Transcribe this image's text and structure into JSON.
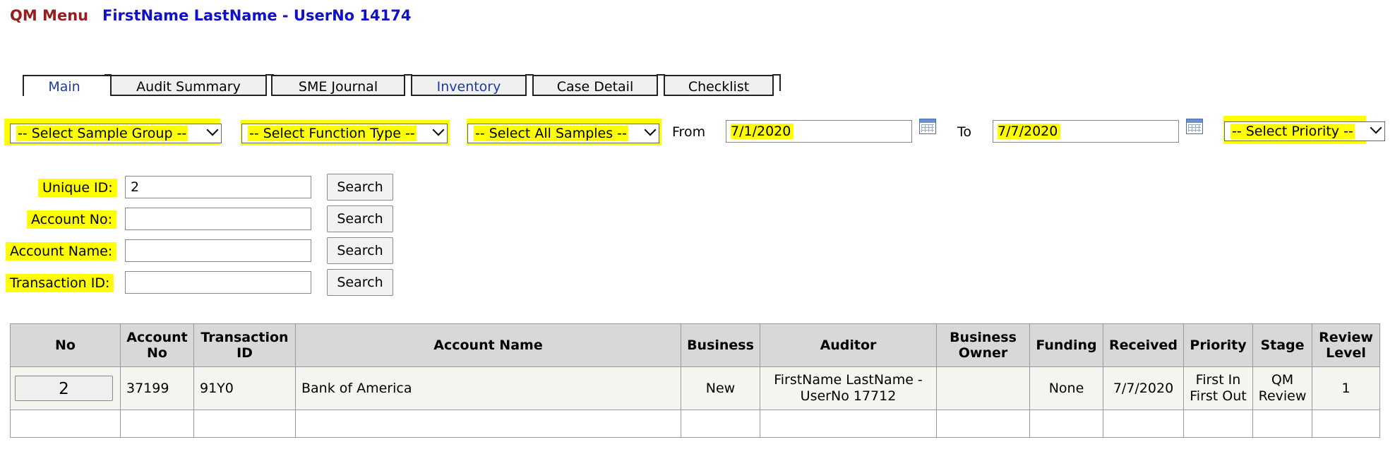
{
  "header": {
    "app_title": "QM Menu",
    "user": "FirstName LastName - UserNo 14174"
  },
  "tabs": [
    {
      "label": "Main"
    },
    {
      "label": "Audit Summary"
    },
    {
      "label": "SME Journal"
    },
    {
      "label": "Inventory"
    },
    {
      "label": "Case Detail"
    },
    {
      "label": "Checklist"
    }
  ],
  "filters": {
    "sample_group": "-- Select Sample Group --",
    "function_type": "-- Select Function Type --",
    "all_samples": "-- Select All Samples --",
    "from_label": "From",
    "from_value": "7/1/2020",
    "to_label": "To",
    "to_value": "7/7/2020",
    "priority": "-- Select Priority --"
  },
  "search": {
    "button_label": "Search",
    "fields": [
      {
        "label": "Unique ID:",
        "value": "2"
      },
      {
        "label": "Account No:",
        "value": ""
      },
      {
        "label": "Account Name:",
        "value": ""
      },
      {
        "label": "Transaction ID:",
        "value": ""
      }
    ]
  },
  "table": {
    "headers": {
      "no": "No",
      "account_no": "Account No",
      "transaction_id": "Transaction ID",
      "account_name": "Account Name",
      "business": "Business",
      "auditor": "Auditor",
      "business_owner": "Business Owner",
      "funding": "Funding",
      "received": "Received",
      "priority": "Priority",
      "stage": "Stage",
      "review_level": "Review Level"
    },
    "rows": [
      {
        "no": "2",
        "account_no": "37199",
        "transaction_id": "91Y0",
        "account_name": "Bank of America",
        "business": "New",
        "auditor": "FirstName LastName - UserNo 17712",
        "business_owner": "",
        "funding": "None",
        "received": "7/7/2020",
        "priority": "First In First Out",
        "stage": "QM Review",
        "review_level": "1"
      }
    ]
  }
}
